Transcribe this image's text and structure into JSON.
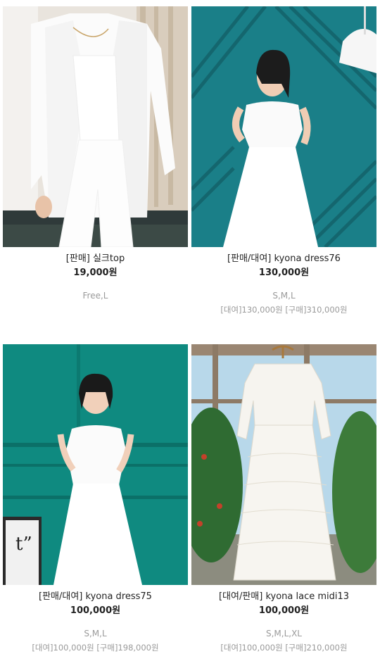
{
  "products": [
    {
      "name": "[판매] 실크top",
      "price": "19,000원",
      "sizes": "Free,L",
      "extra": ""
    },
    {
      "name": "[판매/대여] kyona dress76",
      "price": "130,000원",
      "sizes": "S,M,L",
      "extra": "[대여]130,000원 [구매]310,000원"
    },
    {
      "name": "[판매/대여] kyona dress75",
      "price": "100,000원",
      "sizes": "S,M,L",
      "extra": "[대여]100,000원 [구매]198,000원"
    },
    {
      "name": "[대여/판매] kyona lace midi13",
      "price": "100,000원",
      "sizes": "S,M,L,XL",
      "extra": "[대여]100,000원 [구매]210,000원"
    }
  ],
  "colors": {
    "teal_wall": "#1a7f88",
    "emerald_wall": "#0f8a80",
    "text_dark": "#222222",
    "text_muted": "#9a9a9a"
  }
}
